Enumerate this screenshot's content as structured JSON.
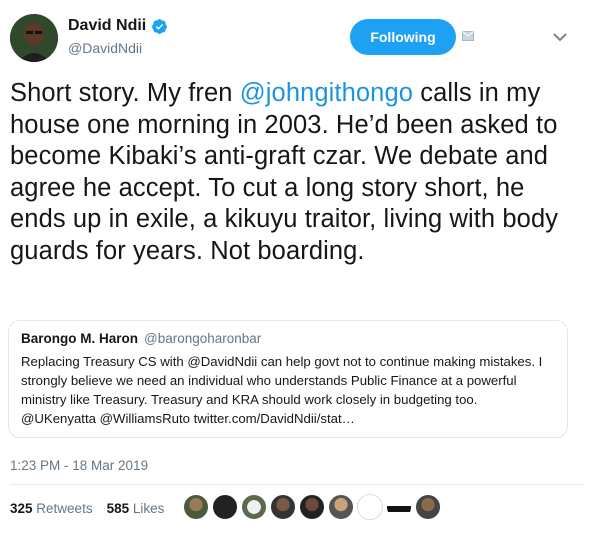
{
  "author": {
    "display_name": "David Ndii",
    "handle": "@DavidNdii",
    "verified_icon": "verified-badge-icon",
    "avatar_icon": "avatar"
  },
  "actions": {
    "follow_label": "Following",
    "dm_icon": "envelope-icon",
    "menu_icon": "chevron-down-icon"
  },
  "tweet": {
    "text_1": "Short story. My fren ",
    "mention": "@johngithongo",
    "text_2": " calls in my house one morning in 2003. He’d been asked to become Kibaki’s anti-graft czar. We debate and agree he accept. To cut a long story short, he ends up in exile, a kikuyu traitor, living with body guards for years. Not boarding."
  },
  "quoted": {
    "name": "Barongo M. Haron",
    "handle": "@barongoharonbar",
    "text": "Replacing Treasury CS with @DavidNdii can help govt not to continue making mistakes. I strongly believe we need an individual who understands Public Finance at a powerful ministry like Treasury.  Treasury and KRA should work closely in budgeting too. @UKenyatta @WilliamsRuto twitter.com/DavidNdii/stat…"
  },
  "timestamp": "1:23 PM - 18 Mar 2019",
  "stats": {
    "retweets_count": "325",
    "retweets_label": "Retweets",
    "likes_count": "585",
    "likes_label": "Likes"
  },
  "colors": {
    "accent": "#1da1f2",
    "link": "#1b95e0",
    "secondary_text": "#657786"
  }
}
